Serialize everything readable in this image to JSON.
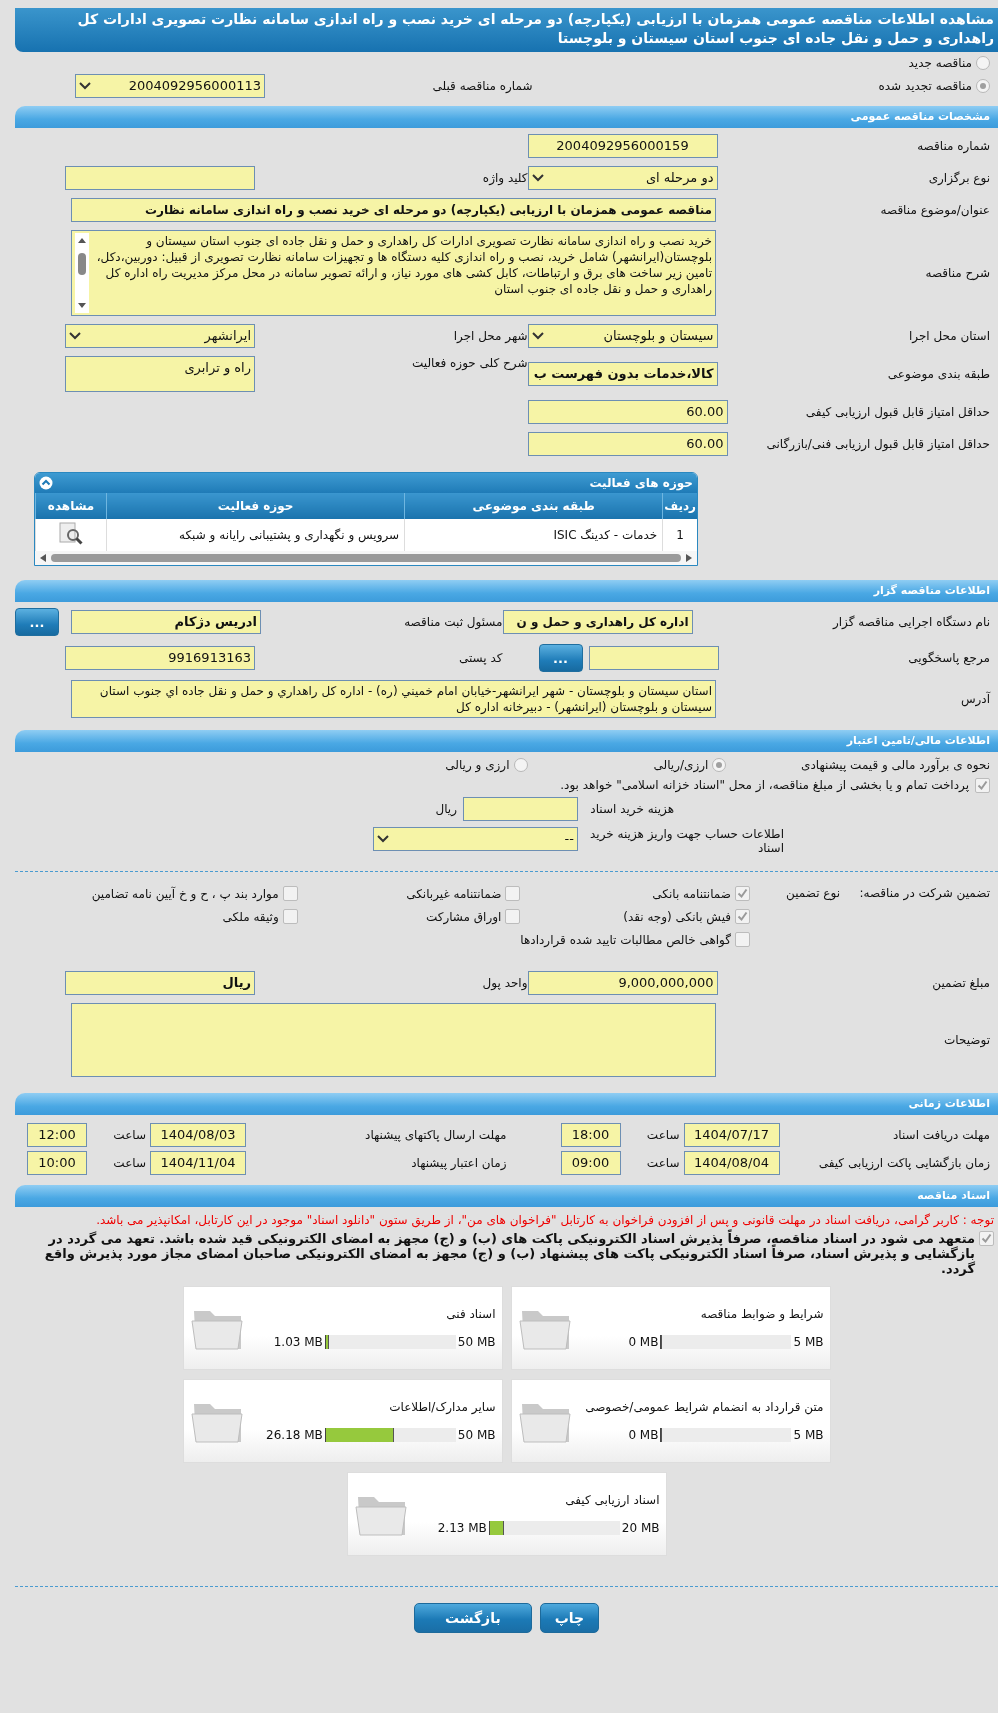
{
  "title": "مشاهده اطلاعات مناقصه عمومی همزمان با ارزیابی (یکپارچه) دو مرحله ای خرید نصب و راه اندازی سامانه نظارت تصویری ادارات کل راهداری و حمل و نقل جاده ای جنوب استان سیستان و بلوچستا",
  "tender_status": [
    {
      "label": "مناقصه جدید",
      "selected": false
    },
    {
      "label": "مناقصه تجدید شده",
      "selected": true
    }
  ],
  "previous_tender": {
    "label": "شماره مناقصه قبلی",
    "value": "2004092956000113"
  },
  "general": {
    "heading": "مشخصات مناقصه عمومی",
    "tender_number": {
      "label": "شماره مناقصه",
      "value": "2004092956000159"
    },
    "holding_type": {
      "label": "نوع برگزاری",
      "value": "دو مرحله ای"
    },
    "keyword": {
      "label": "کلید واژه"
    },
    "subject": {
      "label": "عنوان/موضوع مناقصه",
      "value": "مناقصه عمومی همزمان با ارزیابی (یکپارچه) دو مرحله ای خرید نصب و راه اندازی سامانه نظارت"
    },
    "description": {
      "label": "شرح مناقصه",
      "value": "خرید نصب و راه اندازی سامانه نظارت تصویری ادارات کل راهداری و حمل و نقل جاده ای جنوب استان سیستان و بلوچستان(ایرانشهر) شامل خرید، نصب و راه اندازی کلیه دستگاه ها و تجهیزات سامانه نظارت تصویری از قبیل: دوربین،دکل، تامین زیر ساخت های برق و ارتباطات، کابل کشی های مورد نیاز، و ارائه تصویر سامانه در محل مرکز مدیریت راه اداره کل راهداری و حمل و نقل جاده ای جنوب استان"
    },
    "province": {
      "label": "استان محل اجرا",
      "value": "سیستان و بلوچستان"
    },
    "city": {
      "label": "شهر محل اجرا",
      "value": "ایرانشهر"
    },
    "category": {
      "label": "طبقه بندی موضوعی",
      "value": "کالا،خدمات بدون فهرست ب"
    },
    "activity_summary": {
      "label": "شرح کلی حوزه فعالیت",
      "value": "راه و ترابری"
    },
    "min_quality_score": {
      "label": "حداقل امتیاز قابل قبول ارزیابی کیفی",
      "value": "60.00"
    },
    "min_technical_score": {
      "label": "حداقل امتیاز قابل قبول ارزیابی فنی/بازرگانی",
      "value": "60.00"
    },
    "activities": {
      "title": "حوزه های فعالیت",
      "expanded": true,
      "columns": [
        "ردیف",
        "طبقه بندی موضوعی",
        "حوزه فعالیت",
        "مشاهده"
      ],
      "rows": [
        [
          "1",
          "خدمات - کدینگ ISIC",
          "سرویس و نگهداری و پشتیبانی رایانه و شبکه"
        ]
      ]
    }
  },
  "organizer": {
    "heading": "اطلاعات مناقصه گزار",
    "organization": {
      "label": "نام دستگاه اجرایی مناقصه گزار",
      "value": "اداره کل راهداری و حمل و ن"
    },
    "registrar": {
      "label": "مسئول ثبت مناقصه",
      "value": "ادریس دژکام",
      "button": "..."
    },
    "reference": {
      "label": "مرجع پاسخگویی",
      "button": "..."
    },
    "postal_code": {
      "label": "کد پستی",
      "value": "9916913163"
    },
    "address": {
      "label": "آدرس",
      "value": "استان سيستان و بلوچستان - شهر ايرانشهر-خيابان امام خميني (ره) - اداره کل راهداري و حمل و نقل جاده اي جنوب استان سيستان و بلوچستان (ايرانشهر) - دبيرخانه اداره کل"
    }
  },
  "finance": {
    "heading": "اطلاعات مالی/تامین اعتبار",
    "estimate_label": "نحوه ی برآورد مالی و قیمت پیشنهادی",
    "estimate_options": [
      {
        "label": "ارزی/ریالی",
        "selected": true
      },
      {
        "label": "ارزی و ریالی",
        "selected": false
      }
    ],
    "treasury": {
      "label": "پرداخت تمام و یا بخشی از مبلغ مناقصه، از محل \"اسناد خزانه اسلامی\" خواهد بود.",
      "checked": true
    },
    "document_fee": {
      "label": "هزینه خرید اسناد",
      "unit": "ریال"
    },
    "account": {
      "label": "اطلاعات حساب جهت واریز هزینه خرید اسناد",
      "value": "--"
    }
  },
  "guarantee": {
    "label": "تضمین شرکت در مناقصه:",
    "type_label": "نوع تضمین",
    "options": [
      {
        "label": "ضمانتنامه بانکی",
        "checked": true
      },
      {
        "label": "ضمانتنامه غیربانکی",
        "checked": false
      },
      {
        "label": "موارد بند پ ، ح و خ آیین نامه تضامین",
        "checked": false
      },
      {
        "label": "فیش بانکی (وجه نقد)",
        "checked": true
      },
      {
        "label": "اوراق مشارکت",
        "checked": false
      },
      {
        "label": "وثیقه ملکی",
        "checked": false
      },
      {
        "label": "گواهی خالص مطالبات تایید شده قراردادها",
        "checked": false
      }
    ],
    "amount": {
      "label": "مبلغ تضمین",
      "value": "9,000,000,000"
    },
    "currency": {
      "label": "واحد پول",
      "value": "ریال"
    },
    "notes": {
      "label": "توضیحات"
    }
  },
  "timing": {
    "heading": "اطلاعات زمانی",
    "items": [
      {
        "label": "مهلت دریافت اسناد",
        "date": "1404/07/17",
        "time_label": "ساعت",
        "time": "18:00"
      },
      {
        "label": "مهلت ارسال پاکتهای پیشنهاد",
        "date": "1404/08/03",
        "time_label": "ساعت",
        "time": "12:00"
      },
      {
        "label": "زمان بازگشایی پاکت ارزیابی کیفی",
        "date": "1404/08/04",
        "time_label": "ساعت",
        "time": "09:00"
      },
      {
        "label": "زمان اعتبار پیشنهاد",
        "date": "1404/11/04",
        "time_label": "ساعت",
        "time": "10:00"
      }
    ]
  },
  "documents": {
    "heading": "اسناد مناقصه",
    "notice": "توجه : کاربر گرامی، دریافت اسناد در مهلت قانونی و پس از افزودن فراخوان به کارتابل \"فراخوان های من\"، از طریق ستون \"دانلود اسناد\" موجود در این کارتابل، امکانپذیر می باشد.",
    "commitment": {
      "label": "متعهد می شود در اسناد مناقصه، صرفاً پذیرش اسناد الکترونیکی پاکت های (ب) و (ج) مجهز به امضای الکترونیکی قید شده باشد. تعهد می گردد در بازگشایی و پذیرش اسناد، صرفاً اسناد الکترونیکی پاکت های پیشنهاد (ب) و (ج) مجهز به امضای الکترونیکی صاحبان امضای مجاز مورد پذیرش واقع گردد.",
      "checked": true
    },
    "files": [
      {
        "name": "شرایط و ضوابط مناقصه",
        "size": "0 MB",
        "max": "5 MB",
        "level": 0
      },
      {
        "name": "اسناد فنی",
        "size": "1.03 MB",
        "max": "50 MB",
        "level": 0.0206
      },
      {
        "name": "متن قرارداد به انضمام شرایط عمومی/خصوصی",
        "size": "0 MB",
        "max": "5 MB",
        "level": 0
      },
      {
        "name": "سایر مدارک/اطلاعات",
        "size": "26.18 MB",
        "max": "50 MB",
        "level": 0.5236
      },
      {
        "name": "اسناد ارزیابی کیفی",
        "size": "2.13 MB",
        "max": "20 MB",
        "level": 0.1065
      }
    ]
  },
  "buttons": [
    "چاپ",
    "بازگشت"
  ]
}
